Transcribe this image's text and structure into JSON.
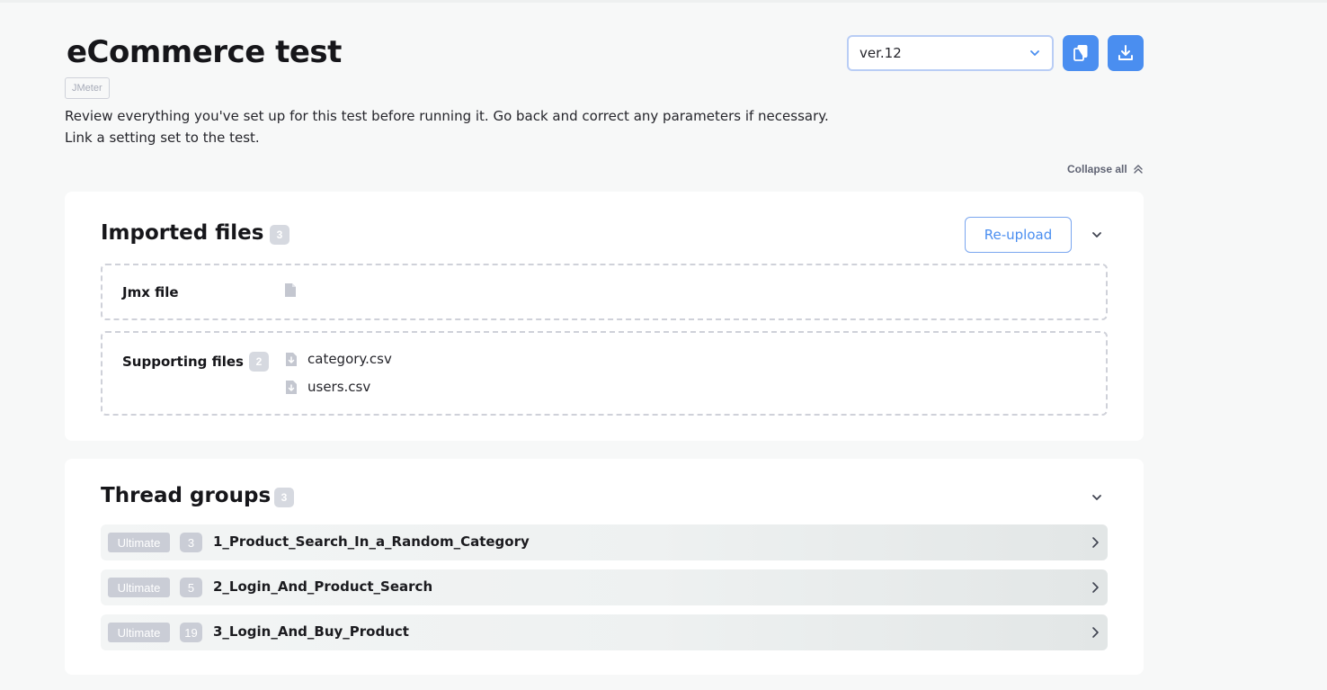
{
  "header": {
    "title": "eCommerce test",
    "tool_badge": "JMeter",
    "description": "Review everything you've set up for this test before running it. Go back and correct any parameters if necessary. Link a setting set to the test.",
    "version_select": {
      "value": "ver.12",
      "icon": "chevron-down-icon"
    },
    "copy_button": {
      "icon": "copy-icon"
    },
    "download_button": {
      "icon": "download-icon"
    },
    "accent_color": "#4a8ef0"
  },
  "collapse_all": {
    "label": "Collapse all",
    "icon": "chevrons-up-icon"
  },
  "imported_files": {
    "title": "Imported files",
    "count": "3",
    "reupload_label": "Re-upload",
    "jmx": {
      "label": "Jmx file",
      "icon": "file-icon"
    },
    "supporting": {
      "label": "Supporting files",
      "count": "2",
      "files": [
        {
          "name": "category.csv",
          "icon": "file-download-icon"
        },
        {
          "name": "users.csv",
          "icon": "file-download-icon"
        }
      ]
    }
  },
  "thread_groups": {
    "title": "Thread groups",
    "count": "3",
    "items": [
      {
        "type": "Ultimate",
        "count": "3",
        "name": "1_Product_Search_In_a_Random_Category"
      },
      {
        "type": "Ultimate",
        "count": "5",
        "name": "2_Login_And_Product_Search"
      },
      {
        "type": "Ultimate",
        "count": "19",
        "name": "3_Login_And_Buy_Product"
      }
    ]
  }
}
